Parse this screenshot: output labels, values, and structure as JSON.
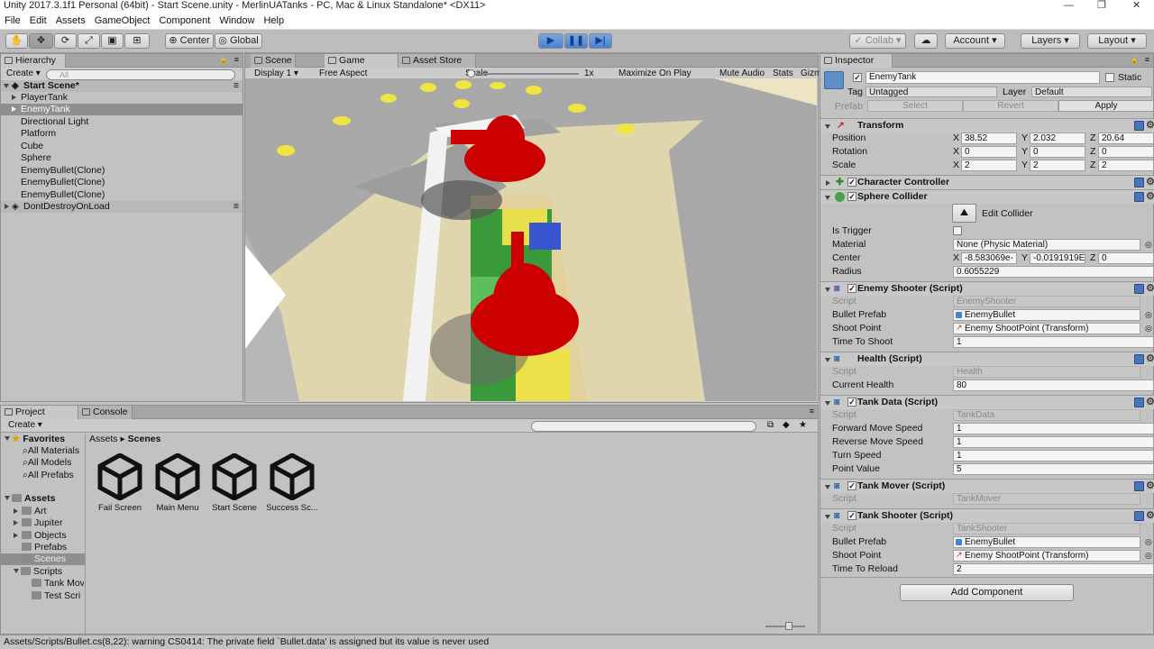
{
  "window": {
    "title": "Unity 2017.3.1f1 Personal (64bit) - Start Scene.unity - MerlinUATanks - PC, Mac & Linux Standalone* <DX11>"
  },
  "menu": [
    "File",
    "Edit",
    "Assets",
    "GameObject",
    "Component",
    "Window",
    "Help"
  ],
  "toolbar": {
    "center": "Center",
    "global": "Global",
    "collab": "Collab",
    "account": "Account",
    "layers": "Layers",
    "layout": "Layout"
  },
  "hierarchy": {
    "tab": "Hierarchy",
    "create": "Create",
    "search_placeholder": "All",
    "scene": "Start Scene*",
    "items": [
      "PlayerTank",
      "EnemyTank",
      "Directional Light",
      "Platform",
      "Cube",
      "Sphere",
      "EnemyBullet(Clone)",
      "EnemyBullet(Clone)",
      "EnemyBullet(Clone)"
    ],
    "dont_destroy": "DontDestroyOnLoad"
  },
  "view_tabs": {
    "scene": "Scene",
    "game": "Game",
    "asset_store": "Asset Store"
  },
  "game_bar": {
    "display": "Display 1",
    "aspect": "Free Aspect",
    "scale_label": "Scale",
    "scale_value": "1x",
    "maximize": "Maximize On Play",
    "mute": "Mute Audio",
    "stats": "Stats",
    "gizmos": "Gizmos"
  },
  "project": {
    "tab": "Project",
    "console_tab": "Console",
    "create": "Create",
    "breadcrumb_root": "Assets",
    "breadcrumb_sep": "▸",
    "breadcrumb_current": "Scenes",
    "favorites": "Favorites",
    "favorite_items": [
      "All Materials",
      "All Models",
      "All Prefabs"
    ],
    "assets": "Assets",
    "folders": [
      "Art",
      "Jupiter",
      "Objects",
      "Prefabs",
      "Scenes",
      "Scripts"
    ],
    "script_folders": [
      "Tank Mov",
      "Test Scri"
    ],
    "scene_assets": [
      "Fail Screen",
      "Main Menu",
      "Start Scene",
      "Success Sc..."
    ]
  },
  "inspector": {
    "tab": "Inspector",
    "object_name": "EnemyTank",
    "static": "Static",
    "tag_label": "Tag",
    "tag_value": "Untagged",
    "layer_label": "Layer",
    "layer_value": "Default",
    "prefab_label": "Prefab",
    "select": "Select",
    "revert": "Revert",
    "apply": "Apply",
    "transform": {
      "title": "Transform",
      "rows": [
        {
          "label": "Position",
          "x": "38.52",
          "y": "2.032",
          "z": "20.64"
        },
        {
          "label": "Rotation",
          "x": "0",
          "y": "0",
          "z": "0"
        },
        {
          "label": "Scale",
          "x": "2",
          "y": "2",
          "z": "2"
        }
      ]
    },
    "character_controller": "Character Controller",
    "sphere_collider": {
      "title": "Sphere Collider",
      "edit": "Edit Collider",
      "is_trigger": "Is Trigger",
      "material_label": "Material",
      "material": "None (Physic Material)",
      "center_label": "Center",
      "cx": "-8.583069e-",
      "cy": "-0.0191919E",
      "cz": "0",
      "radius_label": "Radius",
      "radius": "0.6055229"
    },
    "enemy_shooter": {
      "title": "Enemy Shooter (Script)",
      "script_label": "Script",
      "script": "EnemyShooter",
      "bullet_label": "Bullet Prefab",
      "bullet": "EnemyBullet",
      "shoot_label": "Shoot Point",
      "shoot": "Enemy ShootPoint (Transform)",
      "time_label": "Time To Shoot",
      "time": "1"
    },
    "health": {
      "title": "Health (Script)",
      "script_label": "Script",
      "script": "Health",
      "current_label": "Current Health",
      "current": "80"
    },
    "tank_data": {
      "title": "Tank Data (Script)",
      "script_label": "Script",
      "script": "TankData",
      "fwd_label": "Forward Move Speed",
      "fwd": "1",
      "rev_label": "Reverse Move Speed",
      "rev": "1",
      "turn_label": "Turn Speed",
      "turn": "1",
      "points_label": "Point Value",
      "points": "5"
    },
    "tank_mover": {
      "title": "Tank Mover (Script)",
      "script_label": "Script",
      "script": "TankMover"
    },
    "tank_shooter": {
      "title": "Tank Shooter (Script)",
      "script_label": "Script",
      "script": "TankShooter",
      "bullet_label": "Bullet Prefab",
      "bullet": "EnemyBullet",
      "shoot_label": "Shoot Point",
      "shoot": "Enemy ShootPoint (Transform)",
      "reload_label": "Time To Reload",
      "reload": "2"
    },
    "add_component": "Add Component"
  },
  "status": "Assets/Scripts/Bullet.cs(8,22): warning CS0414: The private field `Bullet.data' is assigned but its value is never used"
}
